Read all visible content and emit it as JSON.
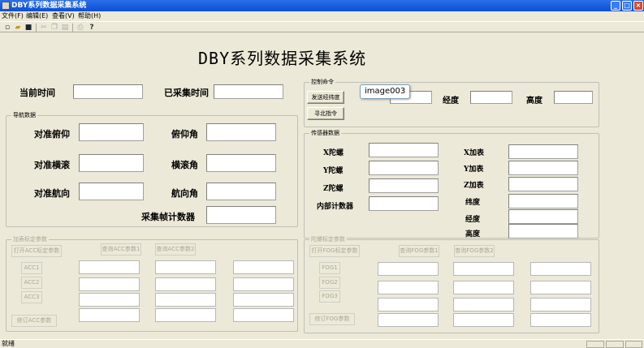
{
  "window": {
    "title": "DBY系列数据采集系统"
  },
  "menu": {
    "file": "文件(F)",
    "edit": "编辑(E)",
    "view": "查看(V)",
    "help": "帮助(H)"
  },
  "main_title": "DBY系列数据采集系统",
  "time": {
    "current_label": "当前时间",
    "elapsed_label": "已采集时间"
  },
  "nav": {
    "group_title": "导航数据",
    "align_pitch": "对准俯仰",
    "align_roll": "对准横滚",
    "align_heading": "对准航向",
    "pitch": "俯仰角",
    "roll": "横滚角",
    "heading": "航向角",
    "frame_counter": "采集帧计数器"
  },
  "control": {
    "group_title": "控制命令",
    "send_latlon": "发送经纬度",
    "find_north": "寻北指令",
    "longitude": "经度",
    "altitude": "高度"
  },
  "tooltip": "image003",
  "sensor": {
    "group_title": "传感器数据",
    "x_gyro": "X陀螺",
    "y_gyro": "Y陀螺",
    "z_gyro": "Z陀螺",
    "internal_counter": "内部计数器",
    "x_acc": "X加表",
    "y_acc": "Y加表",
    "z_acc": "Z加表",
    "latitude": "纬度",
    "longitude": "经度",
    "altitude": "高度"
  },
  "acc_cal": {
    "group_title": "加表标定参数",
    "open": "打开ACC标定参数",
    "query1": "查询ACC参数1",
    "query2": "查询ACC参数2",
    "acc1": "ACC1",
    "acc2": "ACC2",
    "acc3": "ACC3",
    "modify": "修订ACC参数"
  },
  "fog_cal": {
    "group_title": "陀螺标定参数",
    "open": "打开FOG标定参数",
    "query1": "查询FOG参数1",
    "query2": "查询FOG参数2",
    "fog1": "FOG1",
    "fog2": "FOG2",
    "fog3": "FOG3",
    "modify": "修订FOG参数"
  },
  "status": {
    "text": "就绪"
  }
}
